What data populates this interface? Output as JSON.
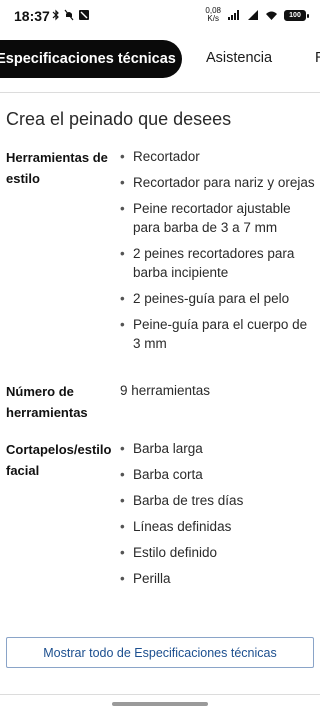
{
  "status_bar": {
    "time": "18:37",
    "speed_value": "0,08",
    "speed_unit": "K/s",
    "battery": "100"
  },
  "tabs": [
    {
      "label": "Especificaciones técnicas",
      "active": true
    },
    {
      "label": "Asistencia",
      "active": false
    },
    {
      "label": "R",
      "active": false
    }
  ],
  "section": {
    "title": "Crea el peinado que desees"
  },
  "specs": [
    {
      "label": "Herramientas de estilo",
      "items": [
        "Recortador",
        "Recortador para nariz y orejas",
        "Peine recortador ajustable para barba de 3 a 7 mm",
        "2 peines recortadores para barba incipiente",
        "2 peines-guía para el pelo",
        "Peine-guía para el cuerpo de 3 mm"
      ]
    },
    {
      "label": "Número de herramientas",
      "value": "9 herramientas"
    },
    {
      "label": "Cortapelos/estilo facial",
      "items": [
        "Barba larga",
        "Barba corta",
        "Barba de tres días",
        "Líneas definidas",
        "Estilo definido",
        "Perilla"
      ]
    }
  ],
  "show_all_button": {
    "label": "Mostrar todo de Especificaciones técnicas"
  },
  "colors": {
    "active_tab_bg": "#0a0a0a",
    "button_border": "#8aa4c8",
    "button_text": "#1c4f8f"
  }
}
